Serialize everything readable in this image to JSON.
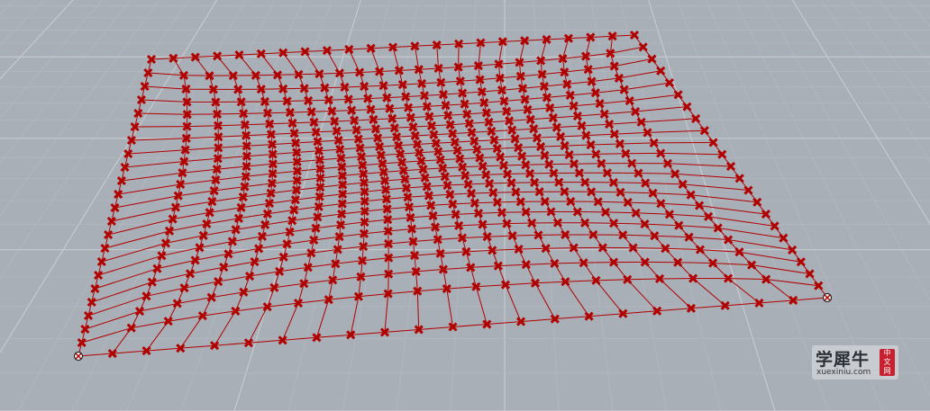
{
  "viewport": {
    "background": "#a9afb7",
    "grid_minor_color": "#b3b8bf",
    "grid_major_color": "#c6cace",
    "mesh_color": "#b00000",
    "corner_point_color": "#ffffff",
    "marker_icon": "x-mark-icon"
  },
  "watermark": {
    "brand_cn": "学犀牛",
    "url": "xuexiniu.com",
    "seal": [
      "中",
      "文",
      "网"
    ],
    "seal_color": "#c8202e"
  }
}
